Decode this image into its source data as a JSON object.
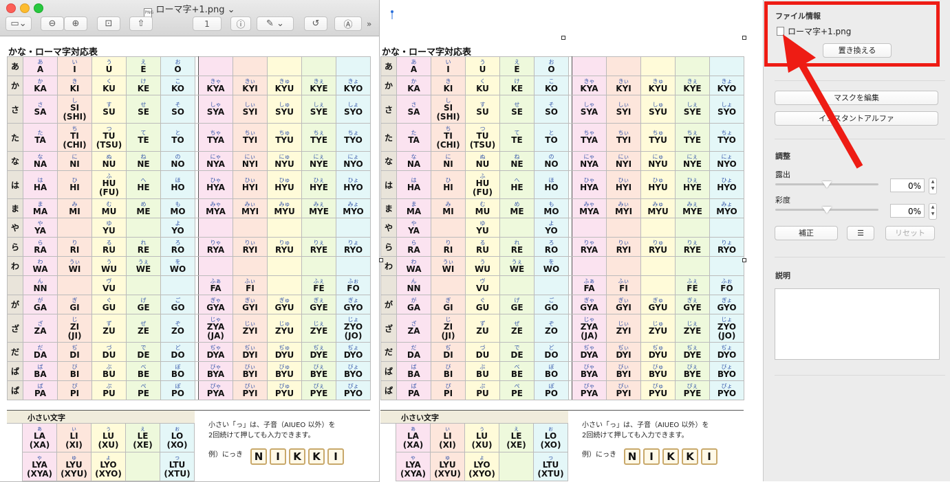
{
  "window": {
    "filename": "ローマ字+1.png",
    "toolbar": {
      "page": "1"
    }
  },
  "chart": {
    "title": "かな・ローマ字対応表",
    "rows": [
      {
        "h": "あ",
        "main": [
          [
            "あ",
            "A"
          ],
          [
            "い",
            "I"
          ],
          [
            "う",
            "U"
          ],
          [
            "え",
            "E"
          ],
          [
            "お",
            "O"
          ]
        ],
        "ext": [
          [
            "",
            ""
          ],
          [
            "",
            ""
          ],
          [
            "",
            ""
          ],
          [
            "",
            ""
          ],
          [
            "",
            ""
          ]
        ]
      },
      {
        "h": "か",
        "main": [
          [
            "か",
            "KA"
          ],
          [
            "き",
            "KI"
          ],
          [
            "く",
            "KU"
          ],
          [
            "け",
            "KE"
          ],
          [
            "こ",
            "KO"
          ]
        ],
        "ext": [
          [
            "きゃ",
            "KYA"
          ],
          [
            "きぃ",
            "KYI"
          ],
          [
            "きゅ",
            "KYU"
          ],
          [
            "きぇ",
            "KYE"
          ],
          [
            "きょ",
            "KYO"
          ]
        ]
      },
      {
        "h": "さ",
        "main": [
          [
            "さ",
            "SA"
          ],
          [
            "し",
            "SI",
            "(SHI)"
          ],
          [
            "す",
            "SU"
          ],
          [
            "せ",
            "SE"
          ],
          [
            "そ",
            "SO"
          ]
        ],
        "ext": [
          [
            "しゃ",
            "SYA"
          ],
          [
            "しぃ",
            "SYI"
          ],
          [
            "しゅ",
            "SYU"
          ],
          [
            "しぇ",
            "SYE"
          ],
          [
            "しょ",
            "SYO"
          ]
        ]
      },
      {
        "h": "た",
        "main": [
          [
            "た",
            "TA"
          ],
          [
            "ち",
            "TI",
            "(CHI)"
          ],
          [
            "つ",
            "TU",
            "(TSU)"
          ],
          [
            "て",
            "TE"
          ],
          [
            "と",
            "TO"
          ]
        ],
        "ext": [
          [
            "ちゃ",
            "TYA"
          ],
          [
            "ちぃ",
            "TYI"
          ],
          [
            "ちゅ",
            "TYU"
          ],
          [
            "ちぇ",
            "TYE"
          ],
          [
            "ちょ",
            "TYO"
          ]
        ]
      },
      {
        "h": "な",
        "main": [
          [
            "な",
            "NA"
          ],
          [
            "に",
            "NI"
          ],
          [
            "ぬ",
            "NU"
          ],
          [
            "ね",
            "NE"
          ],
          [
            "の",
            "NO"
          ]
        ],
        "ext": [
          [
            "にゃ",
            "NYA"
          ],
          [
            "にぃ",
            "NYI"
          ],
          [
            "にゅ",
            "NYU"
          ],
          [
            "にぇ",
            "NYE"
          ],
          [
            "にょ",
            "NYO"
          ]
        ]
      },
      {
        "h": "は",
        "main": [
          [
            "は",
            "HA"
          ],
          [
            "ひ",
            "HI"
          ],
          [
            "ふ",
            "HU",
            "(FU)"
          ],
          [
            "へ",
            "HE"
          ],
          [
            "ほ",
            "HO"
          ]
        ],
        "ext": [
          [
            "ひゃ",
            "HYA"
          ],
          [
            "ひぃ",
            "HYI"
          ],
          [
            "ひゅ",
            "HYU"
          ],
          [
            "ひぇ",
            "HYE"
          ],
          [
            "ひょ",
            "HYO"
          ]
        ]
      },
      {
        "h": "ま",
        "main": [
          [
            "ま",
            "MA"
          ],
          [
            "み",
            "MI"
          ],
          [
            "む",
            "MU"
          ],
          [
            "め",
            "ME"
          ],
          [
            "も",
            "MO"
          ]
        ],
        "ext": [
          [
            "みゃ",
            "MYA"
          ],
          [
            "みぃ",
            "MYI"
          ],
          [
            "みゅ",
            "MYU"
          ],
          [
            "みぇ",
            "MYE"
          ],
          [
            "みょ",
            "MYO"
          ]
        ]
      },
      {
        "h": "や",
        "main": [
          [
            "や",
            "YA"
          ],
          [
            "",
            ""
          ],
          [
            "ゆ",
            "YU"
          ],
          [
            "",
            ""
          ],
          [
            "よ",
            "YO"
          ]
        ],
        "ext": [
          [
            "",
            ""
          ],
          [
            "",
            ""
          ],
          [
            "",
            ""
          ],
          [
            "",
            ""
          ],
          [
            "",
            ""
          ]
        ]
      },
      {
        "h": "ら",
        "main": [
          [
            "ら",
            "RA"
          ],
          [
            "り",
            "RI"
          ],
          [
            "る",
            "RU"
          ],
          [
            "れ",
            "RE"
          ],
          [
            "ろ",
            "RO"
          ]
        ],
        "ext": [
          [
            "りゃ",
            "RYA"
          ],
          [
            "りぃ",
            "RYI"
          ],
          [
            "りゅ",
            "RYU"
          ],
          [
            "りぇ",
            "RYE"
          ],
          [
            "りょ",
            "RYO"
          ]
        ]
      },
      {
        "h": "わ",
        "main": [
          [
            "わ",
            "WA"
          ],
          [
            "うぃ",
            "WI"
          ],
          [
            "う",
            "WU"
          ],
          [
            "うぇ",
            "WE"
          ],
          [
            "を",
            "WO"
          ]
        ],
        "ext": [
          [
            "",
            ""
          ],
          [
            "",
            ""
          ],
          [
            "",
            ""
          ],
          [
            "",
            ""
          ],
          [
            "",
            ""
          ]
        ]
      },
      {
        "h": "",
        "main": [
          [
            "ん",
            "NN"
          ],
          [
            "",
            ""
          ],
          [
            "ヴ",
            "VU"
          ],
          [
            "",
            ""
          ],
          [
            "",
            ""
          ]
        ],
        "ext": [
          [
            "ふぁ",
            "FA"
          ],
          [
            "ふぃ",
            "FI"
          ],
          [
            "",
            ""
          ],
          [
            "ふぇ",
            "FE"
          ],
          [
            "ふぉ",
            "FO"
          ]
        ]
      },
      {
        "h": "が",
        "main": [
          [
            "が",
            "GA"
          ],
          [
            "ぎ",
            "GI"
          ],
          [
            "ぐ",
            "GU"
          ],
          [
            "げ",
            "GE"
          ],
          [
            "ご",
            "GO"
          ]
        ],
        "ext": [
          [
            "ぎゃ",
            "GYA"
          ],
          [
            "ぎぃ",
            "GYI"
          ],
          [
            "ぎゅ",
            "GYU"
          ],
          [
            "ぎぇ",
            "GYE"
          ],
          [
            "ぎょ",
            "GYO"
          ]
        ]
      },
      {
        "h": "ざ",
        "main": [
          [
            "ざ",
            "ZA"
          ],
          [
            "じ",
            "ZI",
            "(JI)"
          ],
          [
            "ず",
            "ZU"
          ],
          [
            "ぜ",
            "ZE"
          ],
          [
            "ぞ",
            "ZO"
          ]
        ],
        "ext": [
          [
            "じゃ",
            "ZYA",
            "(JA)"
          ],
          [
            "じぃ",
            "ZYI"
          ],
          [
            "じゅ",
            "ZYU"
          ],
          [
            "じぇ",
            "ZYE"
          ],
          [
            "じょ",
            "ZYO",
            "(JO)"
          ]
        ]
      },
      {
        "h": "だ",
        "main": [
          [
            "だ",
            "DA"
          ],
          [
            "ぢ",
            "DI"
          ],
          [
            "づ",
            "DU"
          ],
          [
            "で",
            "DE"
          ],
          [
            "ど",
            "DO"
          ]
        ],
        "ext": [
          [
            "ぢゃ",
            "DYA"
          ],
          [
            "ぢぃ",
            "DYI"
          ],
          [
            "ぢゅ",
            "DYU"
          ],
          [
            "ぢぇ",
            "DYE"
          ],
          [
            "ぢょ",
            "DYO"
          ]
        ]
      },
      {
        "h": "ば",
        "main": [
          [
            "ば",
            "BA"
          ],
          [
            "び",
            "BI"
          ],
          [
            "ぶ",
            "BU"
          ],
          [
            "べ",
            "BE"
          ],
          [
            "ぼ",
            "BO"
          ]
        ],
        "ext": [
          [
            "びゃ",
            "BYA"
          ],
          [
            "びぃ",
            "BYI"
          ],
          [
            "びゅ",
            "BYU"
          ],
          [
            "びぇ",
            "BYE"
          ],
          [
            "びょ",
            "BYO"
          ]
        ]
      },
      {
        "h": "ぱ",
        "main": [
          [
            "ぱ",
            "PA"
          ],
          [
            "ぴ",
            "PI"
          ],
          [
            "ぷ",
            "PU"
          ],
          [
            "ぺ",
            "PE"
          ],
          [
            "ぽ",
            "PO"
          ]
        ],
        "ext": [
          [
            "ぴゃ",
            "PYA"
          ],
          [
            "ぴぃ",
            "PYI"
          ],
          [
            "ぴゅ",
            "PYU"
          ],
          [
            "ぴぇ",
            "PYE"
          ],
          [
            "ぴょ",
            "PYO"
          ]
        ]
      }
    ],
    "small": {
      "title": "小さい文字",
      "row1": [
        [
          "ぁ",
          "LA",
          "(XA)"
        ],
        [
          "ぃ",
          "LI",
          "(XI)"
        ],
        [
          "ぅ",
          "LU",
          "(XU)"
        ],
        [
          "ぇ",
          "LE",
          "(XE)"
        ],
        [
          "ぉ",
          "LO",
          "(XO)"
        ]
      ],
      "row2": [
        [
          "ゃ",
          "LYA",
          "(XYA)"
        ],
        [
          "ゅ",
          "LYU",
          "(XYU)"
        ],
        [
          "ょ",
          "LYO",
          "(XYO)"
        ],
        [
          "",
          ""
        ],
        [
          "っ",
          "LTU",
          "(XTU)"
        ]
      ],
      "note1": "小さい「っ」は、子音（AIUEO 以外）を",
      "note2": "2回続けて押しても入力できます。",
      "example": "例）にっき",
      "tiles": [
        "N",
        "I",
        "K",
        "K",
        "I"
      ]
    }
  },
  "inspector": {
    "file_info_title": "ファイル情報",
    "file_name": "ローマ字+1.png",
    "replace_button": "置き換える",
    "edit_mask_button": "マスクを編集",
    "instant_alpha_button": "インスタントアルファ",
    "adjust_title": "調整",
    "exposure_label": "露出",
    "exposure_value": "0%",
    "exposure_level": 0.5,
    "saturation_label": "彩度",
    "saturation_value": "0%",
    "saturation_level": 0.5,
    "enhance_button": "補正",
    "reset_button": "リセット",
    "description_title": "説明",
    "colors": {
      "annotation": "#ee1c14"
    }
  }
}
